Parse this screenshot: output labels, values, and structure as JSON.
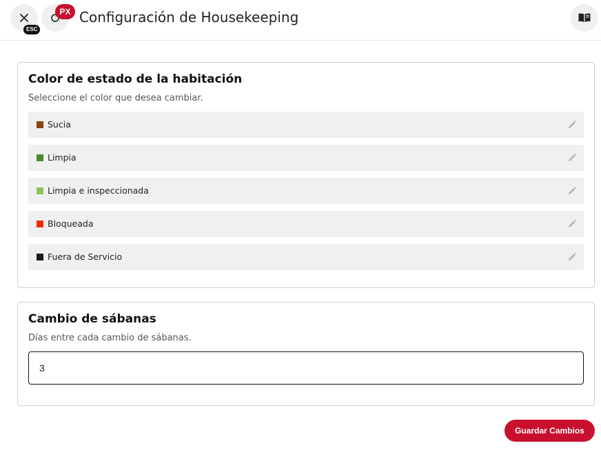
{
  "header": {
    "title": "Configuración de Housekeeping",
    "close_icon": "close-icon",
    "esc_badge": "ESC",
    "refresh_icon": "refresh-icon",
    "px_badge": "PX",
    "book_icon": "book-open-icon"
  },
  "room_status": {
    "title": "Color de estado de la habitación",
    "subtitle": "Seleccione el color que desea cambiar.",
    "items": [
      {
        "label": "Sucia",
        "color": "#8b4513"
      },
      {
        "label": "Limpia",
        "color": "#4a8a2a"
      },
      {
        "label": "Limpia e inspeccionada",
        "color": "#8fc15a"
      },
      {
        "label": "Bloqueada",
        "color": "#f02a0f"
      },
      {
        "label": "Fuera de Servicio",
        "color": "#1a1a1a"
      }
    ],
    "edit_icon": "pencil-icon"
  },
  "sheets": {
    "title": "Cambio de sábanas",
    "subtitle": "Días entre cada cambio de sábanas.",
    "days_value": "3"
  },
  "actions": {
    "save_label": "Guardar Cambios"
  },
  "colors": {
    "accent": "#c8102e",
    "row_background": "#f0f0f0",
    "border": "#cfcfcf"
  }
}
